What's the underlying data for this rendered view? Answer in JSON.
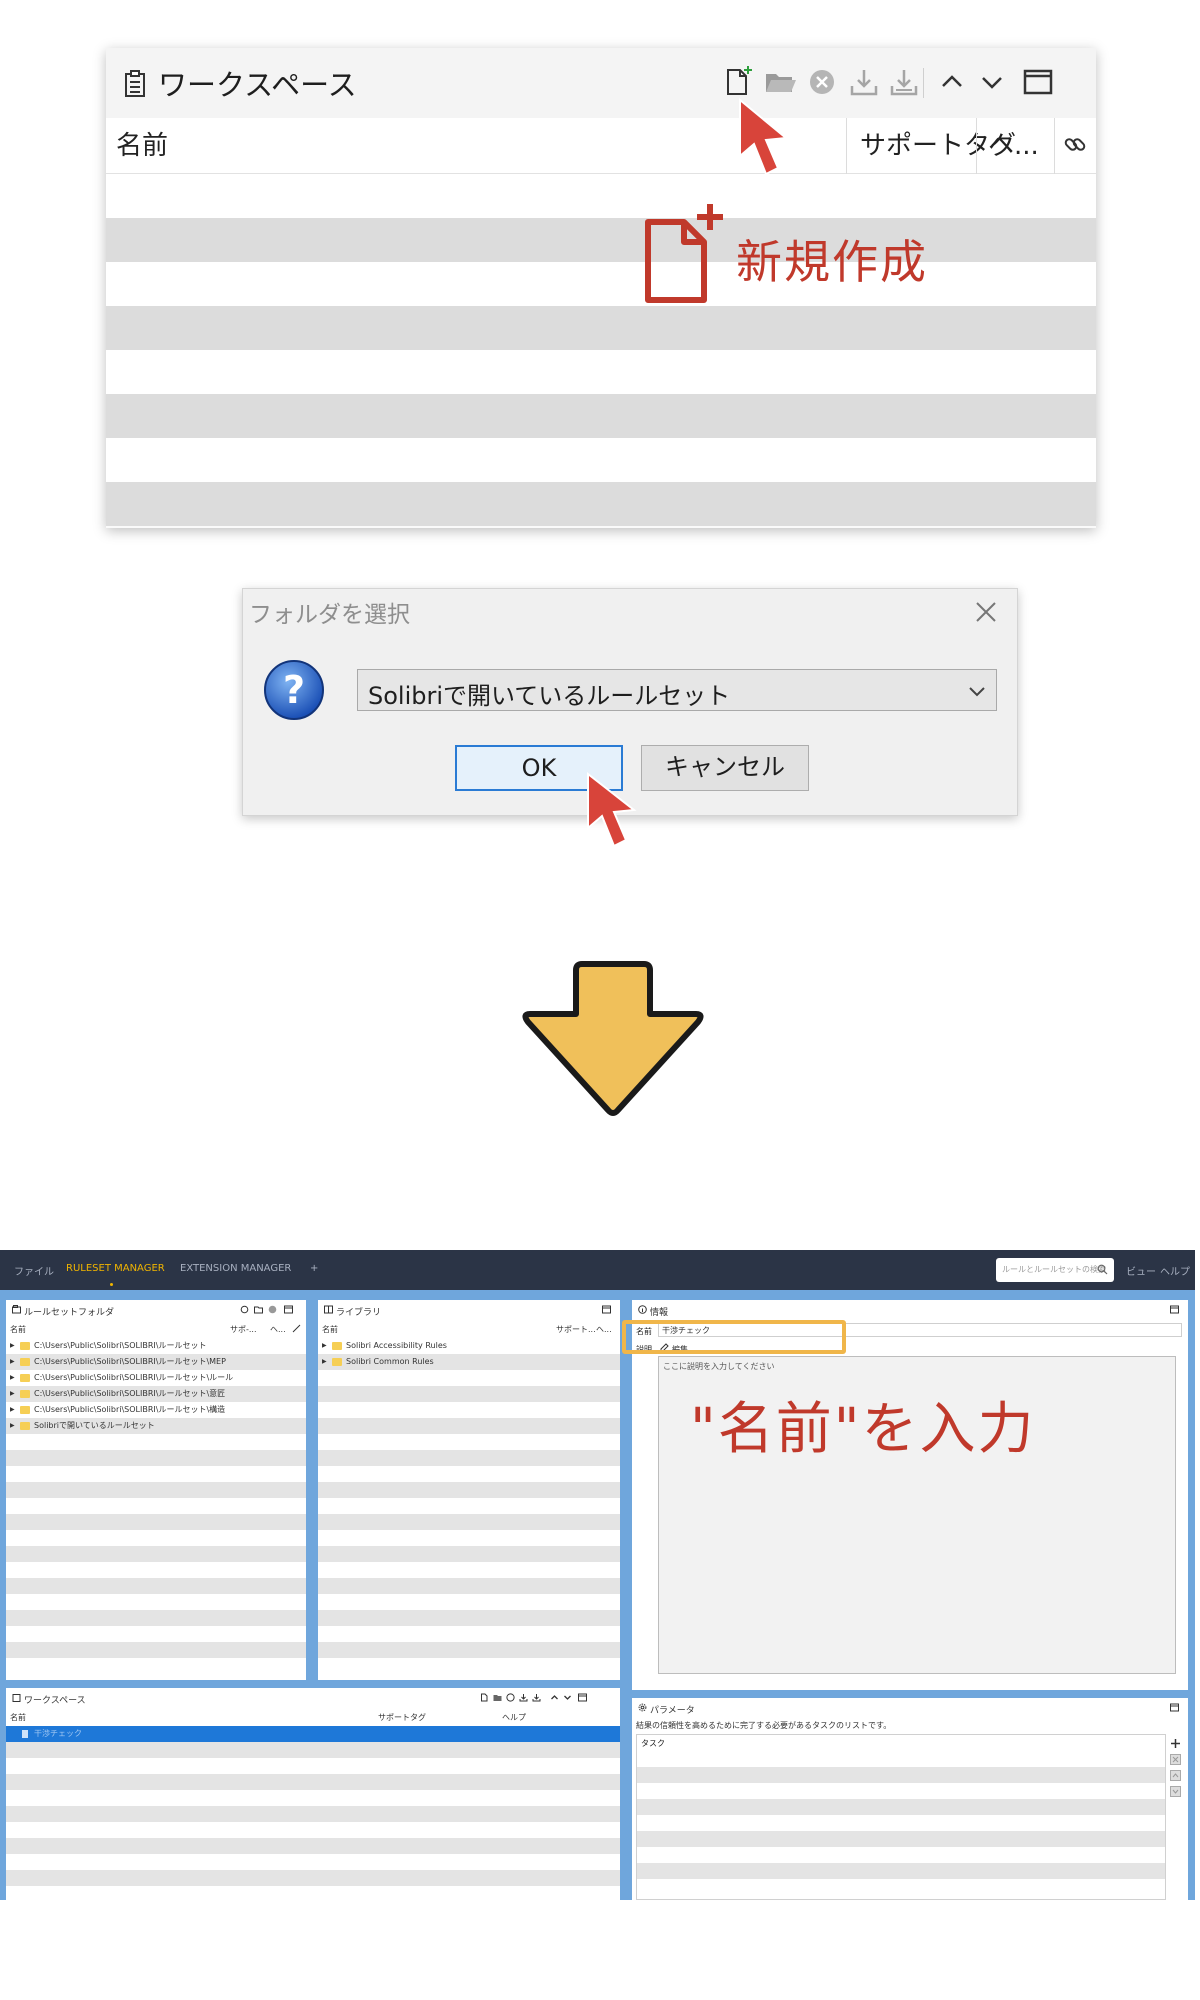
{
  "workspace_top": {
    "title": "ワークスペース",
    "columns": {
      "name": "名前",
      "support_tag": "サポートタグ",
      "help": "ヘ..."
    },
    "toolbar_icons": [
      "new-file-icon",
      "open-folder-icon",
      "remove-icon",
      "import-icon",
      "export-icon",
      "chevron-up-icon",
      "chevron-down-icon",
      "maximize-icon"
    ]
  },
  "annotation_new": {
    "label": "新規作成"
  },
  "folder_dialog": {
    "title": "フォルダを選択",
    "selected_folder": "Solibriで開いているルールセット",
    "ok_label": "OK",
    "cancel_label": "キャンセル"
  },
  "app": {
    "menu": {
      "file": "ファイル",
      "ruleset_manager": "RULESET MANAGER",
      "extension_manager": "EXTENSION MANAGER",
      "add": "+",
      "view": "ビュー",
      "help": "ヘルプ"
    },
    "search_placeholder": "ルールとルールセットの検索",
    "ruleset_folders": {
      "title": "ルールセットフォルダ",
      "col_name": "名前",
      "col_support": "サポ-...",
      "col_help": "ヘ...",
      "items": [
        "C:\\Users\\Public\\Solibri\\SOLIBRI\\ルールセット",
        "C:\\Users\\Public\\Solibri\\SOLIBRI\\ルールセット\\MEP",
        "C:\\Users\\Public\\Solibri\\SOLIBRI\\ルールセット\\ルール",
        "C:\\Users\\Public\\Solibri\\SOLIBRI\\ルールセット\\意匠",
        "C:\\Users\\Public\\Solibri\\SOLIBRI\\ルールセット\\構造",
        "Solibriで開いているルールセット"
      ]
    },
    "library": {
      "title": "ライブラリ",
      "col_name": "名前",
      "col_support": "サポート...",
      "col_help": "ヘ...",
      "items": [
        "Solibri Accessibility Rules",
        "Solibri Common Rules"
      ]
    },
    "info": {
      "title": "情報",
      "name_label": "名前",
      "name_value": "干渉チェック",
      "desc_label": "説明",
      "edit_label": "編集",
      "desc_placeholder": "ここに説明を入力してください"
    },
    "workspace": {
      "title": "ワークスペース",
      "col_name": "名前",
      "col_support": "サポートタグ",
      "col_help": "ヘルプ",
      "selected_row": "干渉チェック"
    },
    "parameters": {
      "title": "パラメータ",
      "description": "結果の信頼性を高めるために完了する必要があるタスクのリストです。",
      "col_task": "タスク"
    }
  },
  "annotation_name": {
    "label": "\"名前\"を入力"
  },
  "colors": {
    "accent_red": "#c0392b",
    "highlight_orange": "#f0b64a",
    "arrow_yellow": "#f0c05a",
    "app_blue": "#6fa6dc",
    "menubar": "#2b3446"
  }
}
